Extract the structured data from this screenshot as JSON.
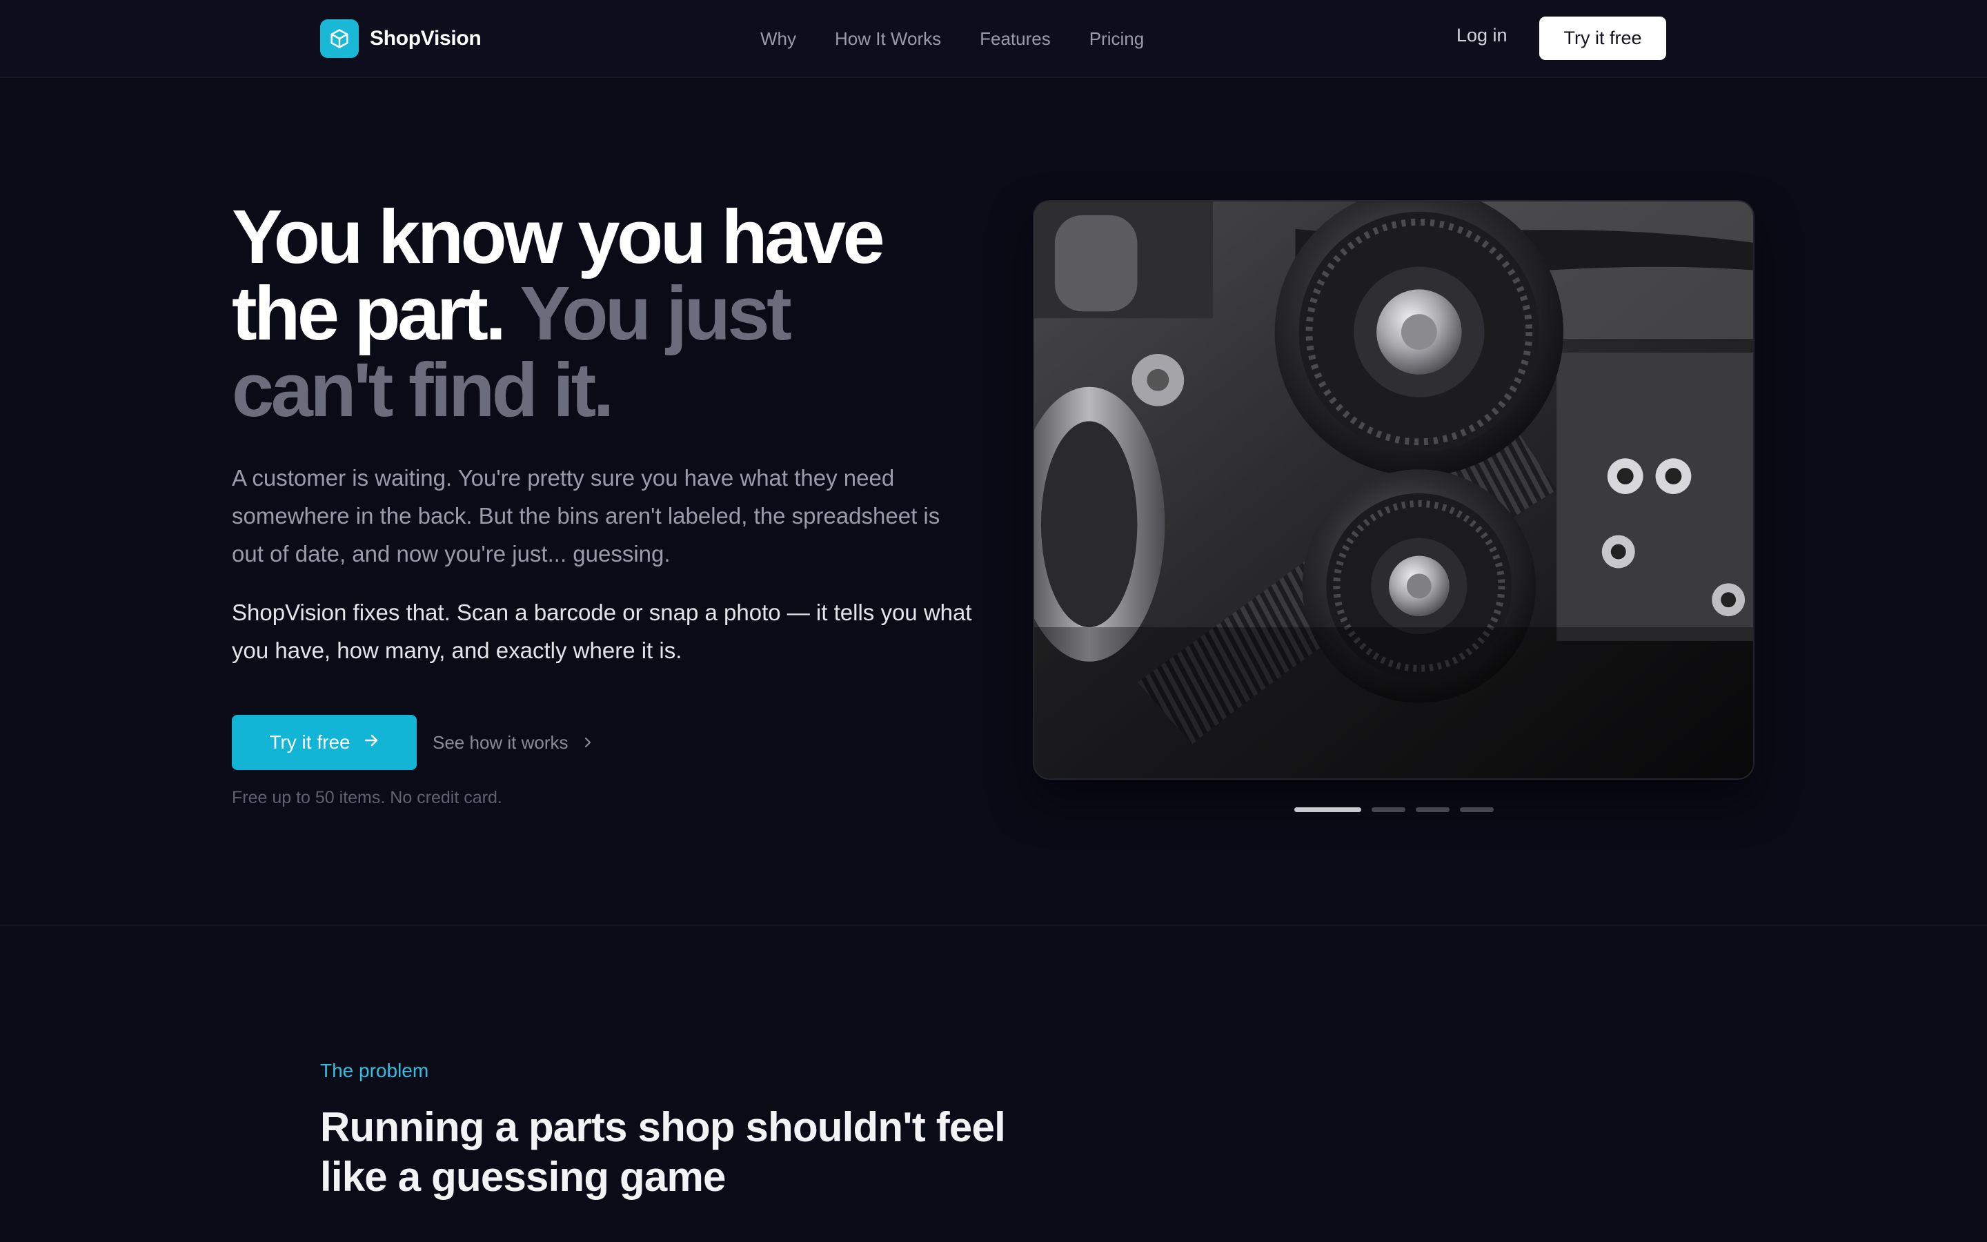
{
  "brand": {
    "name": "ShopVision",
    "logo_icon": "cube-icon",
    "accent": "#18b8d6"
  },
  "nav": {
    "links": [
      "Why",
      "How It Works",
      "Features",
      "Pricing"
    ],
    "login_label": "Log in",
    "cta_label": "Try it free"
  },
  "hero": {
    "title_line1": "You know you have",
    "title_line2_strong": "the part.",
    "title_line2_muted": "You just",
    "title_line3_muted": "can't find it.",
    "paragraph1": "A customer is waiting. You're pretty sure you have what they need somewhere in the back. But the bins aren't labeled, the spreadsheet is out of date, and now you're just... guessing.",
    "paragraph2": "ShopVision fixes that. Scan a barcode or snap a photo — it tells you what you have, how many, and exactly where it is.",
    "primary_cta": "Try it free",
    "primary_cta_icon": "arrow-right-icon",
    "secondary_cta": "See how it works",
    "secondary_cta_icon": "chevron-right-icon",
    "note": "Free up to 50 items. No credit card."
  },
  "carousel": {
    "slide_count": 4,
    "active_index": 0
  },
  "problem_section": {
    "eyebrow": "The problem",
    "title": "Running a parts shop shouldn't feel like a guessing game"
  },
  "colors": {
    "background": "#0b0b17",
    "nav_background": "#0d0d1b",
    "primary_button": "#12b5d5",
    "eyebrow": "#33c0e0",
    "muted_text": "#6b6d7c"
  }
}
